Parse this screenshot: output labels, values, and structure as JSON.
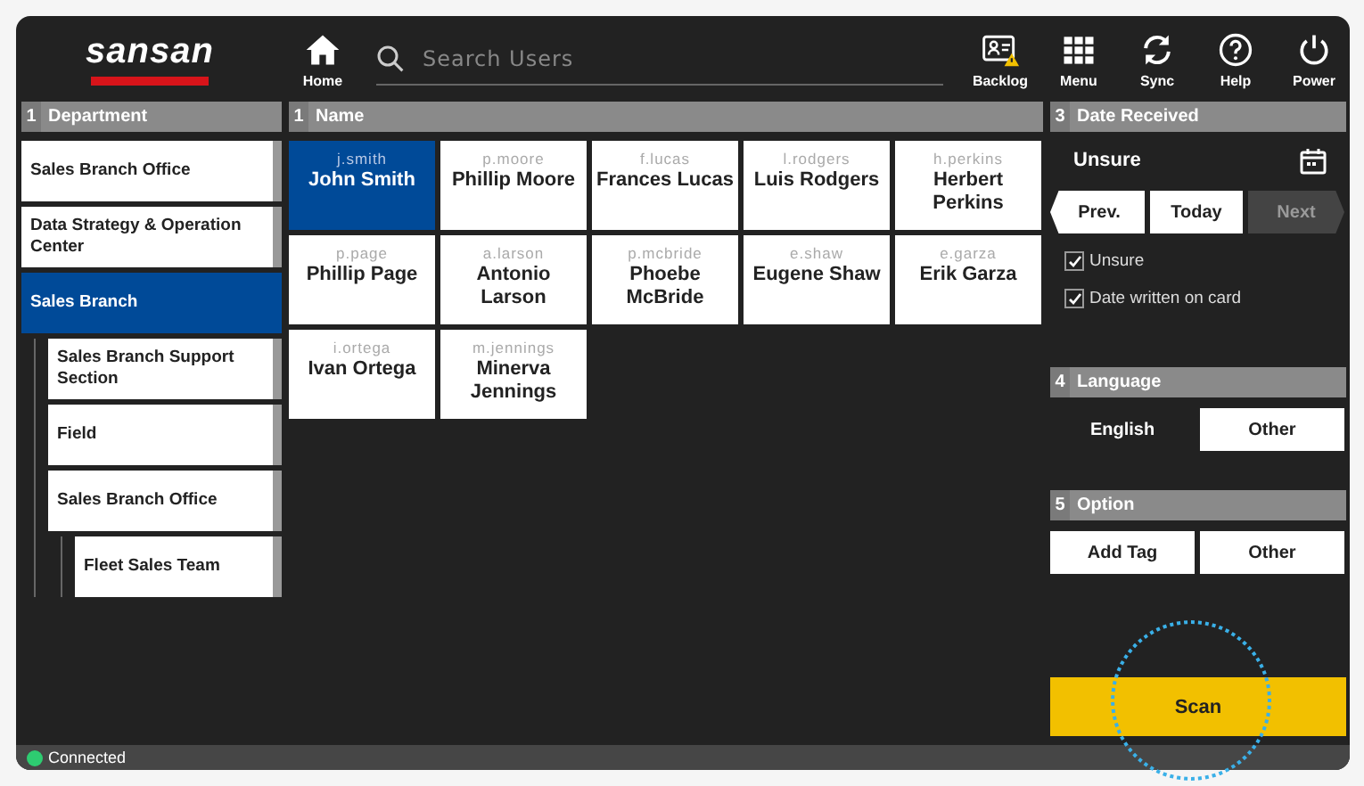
{
  "header": {
    "logo": "sansan",
    "home": "Home",
    "search": {
      "placeholder": "Search Users"
    },
    "actions": [
      {
        "kind": "backlog",
        "label": "Backlog"
      },
      {
        "kind": "menu",
        "label": "Menu"
      },
      {
        "kind": "sync",
        "label": "Sync"
      },
      {
        "kind": "help",
        "label": "Help"
      },
      {
        "kind": "power",
        "label": "Power"
      }
    ]
  },
  "department": {
    "number": "1",
    "title": "Department",
    "items": [
      {
        "label": "Sales Branch Office",
        "selected": false
      },
      {
        "label": "Data Strategy & Operation Center",
        "selected": false
      },
      {
        "label": "Sales Branch",
        "selected": true,
        "children": [
          {
            "label": "Sales Branch Support Section",
            "selected": false
          },
          {
            "label": "Field",
            "selected": false
          },
          {
            "label": "Sales Branch Office",
            "selected": false,
            "children": [
              {
                "label": "Fleet Sales Team",
                "selected": false
              }
            ]
          }
        ]
      }
    ]
  },
  "names": {
    "number": "1",
    "title": "Name",
    "people": [
      {
        "user_id": "j.smith",
        "name": "John Smith",
        "selected": true
      },
      {
        "user_id": "p.moore",
        "name": "Phillip Moore",
        "selected": false
      },
      {
        "user_id": "f.lucas",
        "name": "Frances Lucas",
        "selected": false
      },
      {
        "user_id": "l.rodgers",
        "name": "Luis Rodgers",
        "selected": false
      },
      {
        "user_id": "h.perkins",
        "name": "Herbert Perkins",
        "selected": false
      },
      {
        "user_id": "p.page",
        "name": "Phillip Page",
        "selected": false
      },
      {
        "user_id": "a.larson",
        "name": "Antonio Larson",
        "selected": false
      },
      {
        "user_id": "p.mcbride",
        "name": "Phoebe McBride",
        "selected": false
      },
      {
        "user_id": "e.shaw",
        "name": "Eugene Shaw",
        "selected": false
      },
      {
        "user_id": "e.garza",
        "name": "Erik Garza",
        "selected": false
      },
      {
        "user_id": "i.ortega",
        "name": "Ivan Ortega",
        "selected": false
      },
      {
        "user_id": "m.jennings",
        "name": "Minerva Jennings",
        "selected": false
      }
    ]
  },
  "date_received": {
    "number": "3",
    "title": "Date Received",
    "value": "Unsure",
    "nav": [
      {
        "kind": "prev",
        "label": "Prev.",
        "disabled": false
      },
      {
        "kind": "today",
        "label": "Today",
        "disabled": false
      },
      {
        "kind": "next",
        "label": "Next",
        "disabled": true
      }
    ],
    "checks": [
      {
        "label": "Unsure",
        "checked": true
      },
      {
        "label": "Date written on card",
        "checked": true
      }
    ]
  },
  "language": {
    "number": "4",
    "title": "Language",
    "options": [
      {
        "label": "English",
        "selected": true
      },
      {
        "label": "Other",
        "selected": false
      }
    ]
  },
  "option": {
    "number": "5",
    "title": "Option",
    "buttons": [
      "Add Tag",
      "Other"
    ]
  },
  "scan": {
    "label": "Scan"
  },
  "status_bar": {
    "label": "Connected",
    "connected": true
  }
}
